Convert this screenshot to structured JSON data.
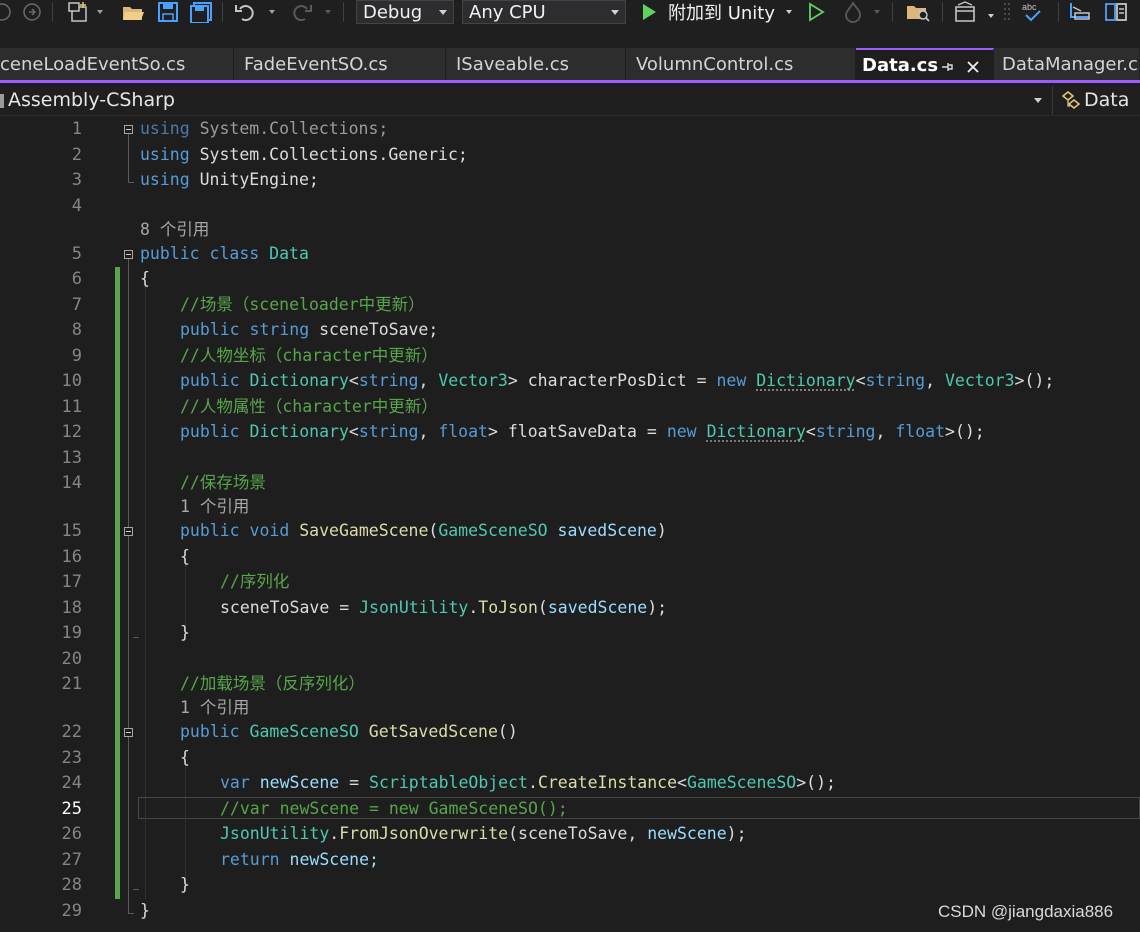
{
  "toolbar": {
    "config_value": "Debug",
    "platform_value": "Any CPU",
    "run_label": "附加到 Unity"
  },
  "tabs": [
    {
      "label": "ceneLoadEventSo.cs",
      "active": false
    },
    {
      "label": "FadeEventSO.cs",
      "active": false
    },
    {
      "label": "ISaveable.cs",
      "active": false
    },
    {
      "label": "VolumnControl.cs",
      "active": false
    },
    {
      "label": "Data.cs",
      "active": true
    },
    {
      "label": "DataManager.cs",
      "active": false
    }
  ],
  "navigation": {
    "project": "Assembly-CSharp",
    "member": "Data"
  },
  "editor": {
    "current_line": "25",
    "line_numbers": [
      "1",
      "2",
      "3",
      "4",
      "5",
      "6",
      "7",
      "8",
      "9",
      "10",
      "11",
      "12",
      "13",
      "14",
      "15",
      "16",
      "17",
      "18",
      "19",
      "20",
      "21",
      "22",
      "23",
      "24",
      "25",
      "26",
      "27",
      "28",
      "29"
    ],
    "codelens": {
      "class_refs": "8 个引用",
      "save_refs": "1 个引用",
      "get_refs": "1 个引用"
    },
    "tokens": {
      "using": "using",
      "ns_collections": "System.Collections;",
      "ns_generic": "System.Collections.Generic;",
      "ns_unity": "UnityEngine;",
      "public": "public",
      "class": "class",
      "data": "Data",
      "brace_open": "{",
      "brace_close": "}",
      "comment_scene": "//场景（sceneloader中更新）",
      "string": "string",
      "scene_to_save_decl": "sceneToSave;",
      "comment_pos": "//人物坐标（character中更新）",
      "dictionary": "Dictionary",
      "lt": "<",
      "comma": ", ",
      "vector3": "Vector3",
      "gt": ">",
      "char_pos_dict": " characterPosDict = ",
      "new": "new",
      "paren_semicolon": "();",
      "comment_attr": "//人物属性（character中更新）",
      "float": "float",
      "float_save_data": " floatSaveData = ",
      "comment_save": "//保存场景",
      "void": "void",
      "save_game_scene": "SaveGameScene",
      "paren_open": "(",
      "game_scene_so": "GameSceneSO",
      "saved_scene": "savedScene",
      "paren_close": ")",
      "comment_serialize": "//序列化",
      "scene_to_save_assign": "sceneToSave = ",
      "json_utility": "JsonUtility",
      "dot": ".",
      "to_json": "ToJson",
      "close_semicolon": ");",
      "comment_load": "//加载场景（反序列化）",
      "get_saved_scene": "GetSavedScene",
      "empty_parens": "()",
      "var": "var",
      "new_scene": "newScene",
      "assign": " = ",
      "scriptable_object": "ScriptableObject",
      "create_instance": "CreateInstance",
      "commented_line": "//var newScene = new GameSceneSO();",
      "from_json_overwrite": "FromJsonOverwrite",
      "scene_to_save_arg": "sceneToSave, ",
      "return": "return",
      "new_scene_semicolon": "newScene;"
    }
  },
  "watermark": "CSDN @jiangdaxia886",
  "colors": {
    "keyword": "#569cd6",
    "type": "#4ec9b0",
    "comment": "#57a64a",
    "method": "#dcdcaa",
    "parameter": "#9cdcfe",
    "accent": "#9d5cff",
    "change_bar": "#57a64a"
  }
}
